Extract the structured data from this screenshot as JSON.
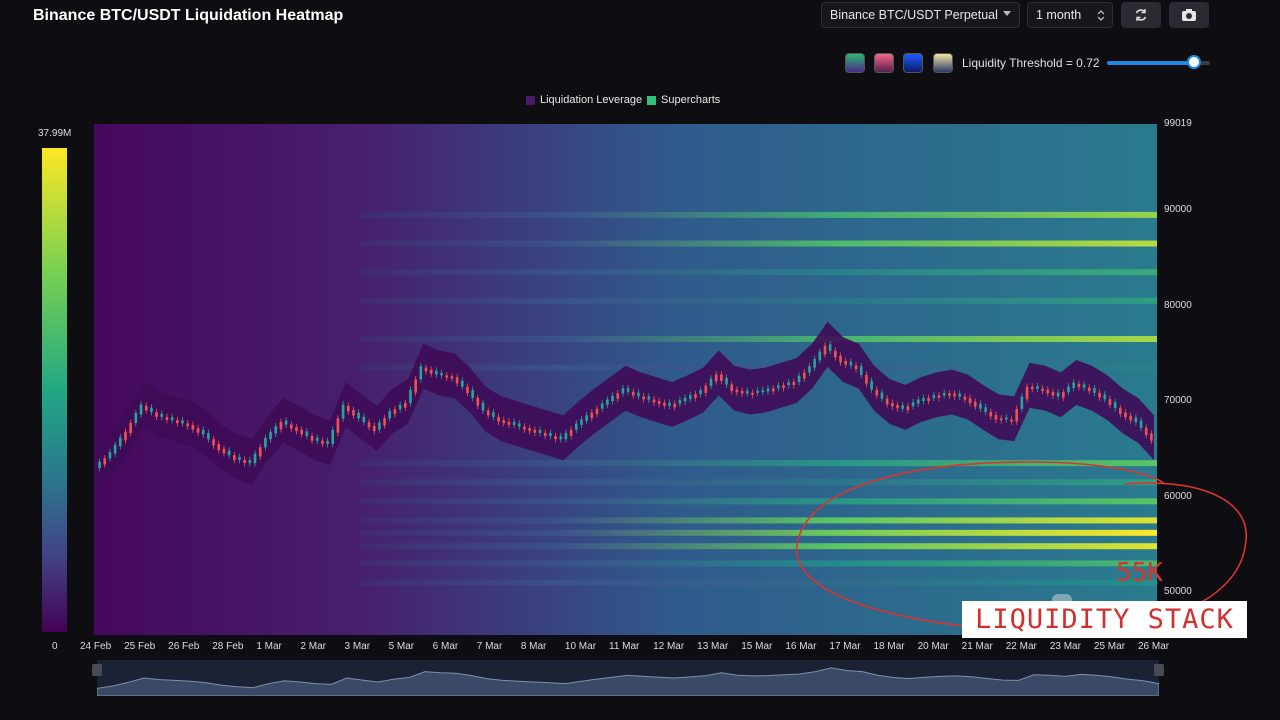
{
  "header": {
    "title": "Binance BTC/USDT Liquidation Heatmap",
    "pair_select": "Binance BTC/USDT Perpetual",
    "range_select": "1 month",
    "refresh_icon": "refresh-icon",
    "camera_icon": "camera-icon"
  },
  "palette_swatches": [
    {
      "name": "viridis-swatch",
      "from": "#2fb46e",
      "to": "#4a2a8c"
    },
    {
      "name": "magma-swatch",
      "from": "#f06a8a",
      "to": "#5a1f4a"
    },
    {
      "name": "blue-swatch",
      "from": "#1e5cff",
      "to": "#0b1a66"
    },
    {
      "name": "cividis-swatch",
      "from": "#f1e6a0",
      "to": "#2b3a6b"
    }
  ],
  "threshold": {
    "label": "Liquidity Threshold = 0.72",
    "value": 0.72
  },
  "colors": {
    "low": "#440154",
    "mid": "#21918c",
    "high": "#fde725",
    "up_candle": "#26a69a",
    "down_candle": "#ef5350",
    "annotation": "#d9352d"
  },
  "colorbar": {
    "max_label": "37.99M",
    "min_label": "0"
  },
  "legend": [
    {
      "label": "Liquidation Leverage",
      "color": "#4b1a6b"
    },
    {
      "label": "Supercharts",
      "color": "#2ec27e"
    }
  ],
  "chart_data": {
    "type": "heatmap",
    "title": "Binance BTC/USDT Liquidation Heatmap",
    "series_names": [
      "Liquidation Leverage",
      "Supercharts"
    ],
    "x_tick_labels": [
      "24 Feb",
      "25 Feb",
      "26 Feb",
      "28 Feb",
      "1 Mar",
      "2 Mar",
      "3 Mar",
      "5 Mar",
      "6 Mar",
      "7 Mar",
      "8 Mar",
      "10 Mar",
      "11 Mar",
      "12 Mar",
      "13 Mar",
      "15 Mar",
      "16 Mar",
      "17 Mar",
      "18 Mar",
      "20 Mar",
      "21 Mar",
      "22 Mar",
      "23 Mar",
      "25 Mar",
      "26 Mar"
    ],
    "y_tick_labels": [
      "99019",
      "90000",
      "80000",
      "70000",
      "60000",
      "50000"
    ],
    "ylim": [
      45500,
      99019
    ],
    "price_series": [
      [
        0,
        63000
      ],
      [
        1,
        64500
      ],
      [
        2,
        66800
      ],
      [
        3,
        69500
      ],
      [
        4,
        68500
      ],
      [
        5,
        68000
      ],
      [
        6,
        67500
      ],
      [
        7,
        66500
      ],
      [
        8,
        65000
      ],
      [
        9,
        64000
      ],
      [
        10,
        63500
      ],
      [
        11,
        66000
      ],
      [
        12,
        67800
      ],
      [
        13,
        67000
      ],
      [
        14,
        66000
      ],
      [
        15,
        65500
      ],
      [
        16,
        69500
      ],
      [
        17,
        68200
      ],
      [
        18,
        67000
      ],
      [
        19,
        68800
      ],
      [
        20,
        69800
      ],
      [
        21,
        73500
      ],
      [
        22,
        72800
      ],
      [
        23,
        72500
      ],
      [
        24,
        71000
      ],
      [
        25,
        69000
      ],
      [
        26,
        68000
      ],
      [
        27,
        67500
      ],
      [
        28,
        67000
      ],
      [
        29,
        66500
      ],
      [
        30,
        66000
      ],
      [
        31,
        67500
      ],
      [
        32,
        68800
      ],
      [
        33,
        70000
      ],
      [
        34,
        71200
      ],
      [
        35,
        70500
      ],
      [
        36,
        70000
      ],
      [
        37,
        69500
      ],
      [
        38,
        70200
      ],
      [
        39,
        71000
      ],
      [
        40,
        72800
      ],
      [
        41,
        71200
      ],
      [
        42,
        70800
      ],
      [
        43,
        71000
      ],
      [
        44,
        71500
      ],
      [
        45,
        72000
      ],
      [
        46,
        73500
      ],
      [
        47,
        75800
      ],
      [
        48,
        74200
      ],
      [
        49,
        73500
      ],
      [
        50,
        71200
      ],
      [
        51,
        69800
      ],
      [
        52,
        69200
      ],
      [
        53,
        70000
      ],
      [
        54,
        70500
      ],
      [
        55,
        70800
      ],
      [
        56,
        70300
      ],
      [
        57,
        69200
      ],
      [
        58,
        68200
      ],
      [
        59,
        68000
      ],
      [
        60,
        71500
      ],
      [
        61,
        71200
      ],
      [
        62,
        70500
      ],
      [
        63,
        71800
      ],
      [
        64,
        71200
      ],
      [
        65,
        70200
      ],
      [
        66,
        68800
      ],
      [
        67,
        67800
      ],
      [
        68,
        66000
      ]
    ],
    "liquidity_bands": [
      {
        "price": 89500,
        "intensity": 0.82
      },
      {
        "price": 86500,
        "intensity": 0.88
      },
      {
        "price": 83500,
        "intensity": 0.6
      },
      {
        "price": 80500,
        "intensity": 0.55
      },
      {
        "price": 76500,
        "intensity": 0.85
      },
      {
        "price": 73500,
        "intensity": 0.45
      },
      {
        "price": 63500,
        "intensity": 0.7
      },
      {
        "price": 61500,
        "intensity": 0.55
      },
      {
        "price": 59500,
        "intensity": 0.7
      },
      {
        "price": 57500,
        "intensity": 0.95
      },
      {
        "price": 56200,
        "intensity": 1.0
      },
      {
        "price": 54800,
        "intensity": 0.95
      },
      {
        "price": 53000,
        "intensity": 0.65
      },
      {
        "price": 51000,
        "intensity": 0.5
      }
    ],
    "grid": false,
    "legend_position": "top-center"
  },
  "annotations": {
    "price_note": "55K",
    "box_label": "LIQUIDITY STACK"
  }
}
